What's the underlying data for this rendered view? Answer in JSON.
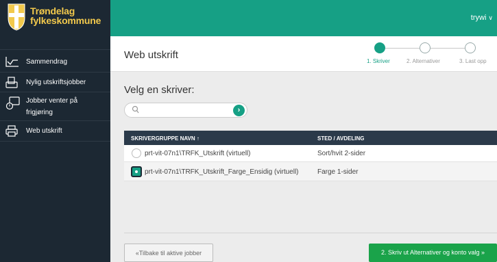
{
  "brand": {
    "line1": "Trøndelag",
    "line2": "fylkeskommune"
  },
  "user": {
    "name": "trywi",
    "chevron": "∨"
  },
  "sidebar": {
    "items": [
      {
        "label": "Sammendrag",
        "icon": "chart-line-icon"
      },
      {
        "label": "Nylig utskriftsjobber",
        "icon": "document-print-icon"
      },
      {
        "label_line1": "Jobber venter på",
        "label_line2": "frigjøring",
        "icon": "pending-jobs-icon"
      },
      {
        "label": "Web utskrift",
        "icon": "printer-icon"
      }
    ]
  },
  "header": {
    "title": "Web utskrift"
  },
  "steps": [
    {
      "label": "1. Skriver",
      "active": true
    },
    {
      "label": "2. Alternativer",
      "active": false
    },
    {
      "label": "3. Last opp",
      "active": false
    }
  ],
  "section": {
    "title": "Velg en skriver:"
  },
  "search": {
    "value": "",
    "placeholder": "",
    "go": "›"
  },
  "table": {
    "columns": [
      "SKRIVERGRUPPE NAVN",
      "STED / AVDELING"
    ],
    "sort_indicator": "↑",
    "rows": [
      {
        "name": "prt-vit-07n1\\TRFK_Utskrift (virtuell)",
        "location": "Sort/hvit 2-sider",
        "selected": false
      },
      {
        "name": "prt-vit-07n1\\TRFK_Utskrift_Farge_Ensidig (virtuell)",
        "location": "Farge 1-sider",
        "selected": true
      }
    ]
  },
  "buttons": {
    "back": "«Tilbake til aktive jobber",
    "next": "2. Skriv ut Alternativer og konto valg »"
  },
  "colors": {
    "accent": "#16a085",
    "sidebar": "#1c2833",
    "next_button": "#1aa34a",
    "crest_yellow": "#f2c94c"
  }
}
